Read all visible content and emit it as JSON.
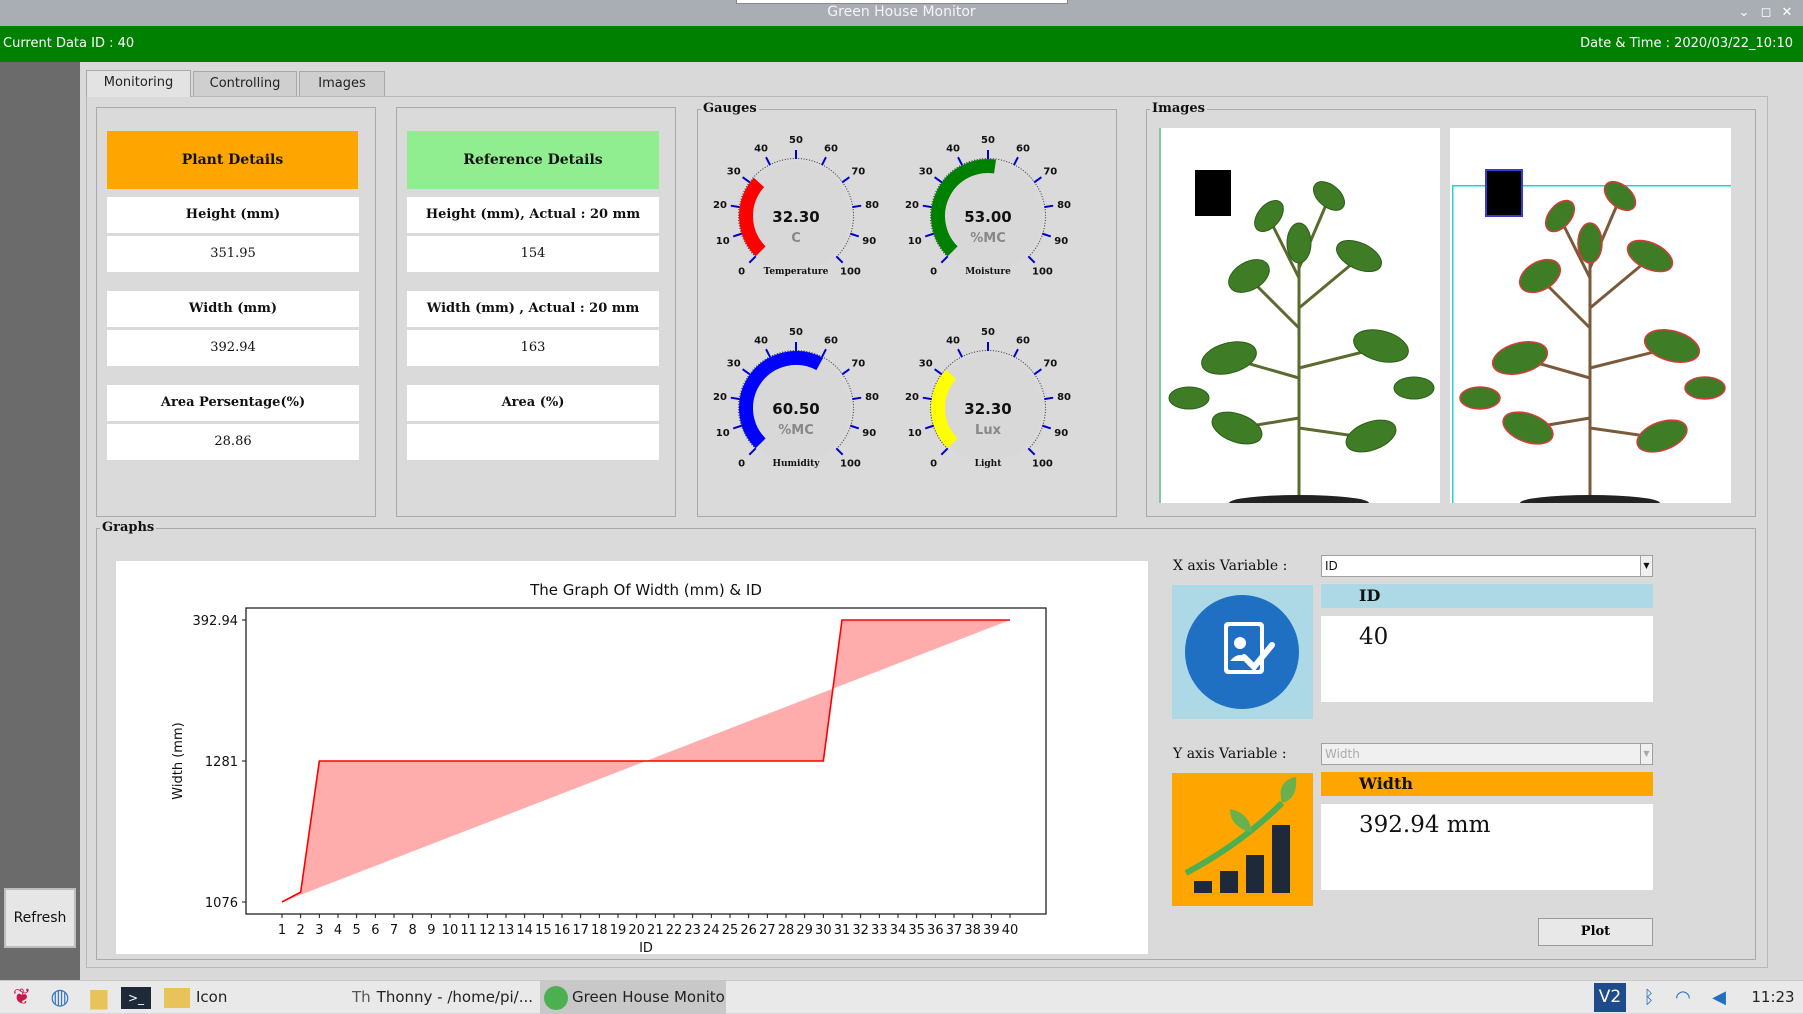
{
  "window": {
    "title": "Green House Monitor"
  },
  "status": {
    "current_id": "Current Data ID : 40",
    "datetime": "Date & Time : 2020/03/22_10:10"
  },
  "rail": {
    "refresh_label": "Refresh"
  },
  "tabs": [
    {
      "label": "Monitoring",
      "active": true
    },
    {
      "label": "Controlling"
    },
    {
      "label": "Images"
    }
  ],
  "plant": {
    "header": "Plant Details",
    "header_color": "#ffa500",
    "rows": [
      {
        "label": "Height (mm)",
        "value": "351.95"
      },
      {
        "label": "Width (mm)",
        "value": "392.94"
      },
      {
        "label": "Area Persentage(%)",
        "value": "28.86"
      }
    ]
  },
  "reference": {
    "header": "Reference Details",
    "header_color": "#90ee90",
    "rows": [
      {
        "label": "Height (mm), Actual : 20 mm",
        "value": "154"
      },
      {
        "label": "Width (mm) , Actual : 20 mm",
        "value": "163"
      },
      {
        "label": "Area (%)",
        "value": ""
      }
    ]
  },
  "gauges": {
    "title": "Gauges",
    "items": [
      {
        "value": "32.30",
        "unit": "C",
        "label": "Temperature",
        "color": "#ff0000",
        "fraction": 0.323
      },
      {
        "value": "53.00",
        "unit": "%MC",
        "label": "Moisture",
        "color": "#008000",
        "fraction": 0.53
      },
      {
        "value": "60.50",
        "unit": "%MC",
        "label": "Humidity",
        "color": "#0000ff",
        "fraction": 0.605
      },
      {
        "value": "32.30",
        "unit": "Lux",
        "label": "Light",
        "color": "#ffff00",
        "fraction": 0.323
      }
    ],
    "ticks": [
      "0",
      "10",
      "20",
      "30",
      "40",
      "50",
      "60",
      "70",
      "80",
      "90",
      "100"
    ]
  },
  "images": {
    "title": "Images"
  },
  "graphs": {
    "title": "Graphs"
  },
  "chart_data": {
    "type": "line",
    "title": "The Graph Of Width (mm) & ID",
    "xlabel": "ID",
    "ylabel": "Width (mm)",
    "categories": [
      "1",
      "2",
      "3",
      "4",
      "5",
      "6",
      "7",
      "8",
      "9",
      "10",
      "11",
      "12",
      "13",
      "14",
      "15",
      "16",
      "17",
      "18",
      "19",
      "20",
      "21",
      "22",
      "23",
      "24",
      "25",
      "26",
      "27",
      "28",
      "29",
      "30",
      "31",
      "32",
      "33",
      "34",
      "35",
      "36",
      "37",
      "38",
      "39",
      "40"
    ],
    "ytick_labels": [
      "392.94",
      "1281",
      "1076"
    ],
    "y_positions": [
      0.0,
      0.07,
      1,
      1,
      1,
      1,
      1,
      1,
      1,
      1,
      1,
      1,
      1,
      1,
      1,
      1,
      1,
      1,
      1,
      1,
      1,
      1,
      1,
      1,
      1,
      1,
      1,
      1,
      1,
      1,
      2,
      2,
      2,
      2,
      2,
      2,
      2,
      2,
      2,
      2
    ],
    "line_color": "#ff0000",
    "fill_color": "#ff9090"
  },
  "controls": {
    "x_label": "X axis Variable :",
    "x_value": "ID",
    "x_var_name": "ID",
    "x_var_value": "40",
    "x_var_color": "#add8e6",
    "y_label": "Y axis Variable :",
    "y_value": "Width",
    "y_var_name": "Width",
    "y_var_value": "392.94 mm",
    "y_var_color": "#ffa500",
    "plot_label": "Plot"
  },
  "taskbar": {
    "items": [
      "Icon",
      "Thonny  -  /home/pi/...",
      "Green House Monitor"
    ],
    "clock": "11:23"
  }
}
